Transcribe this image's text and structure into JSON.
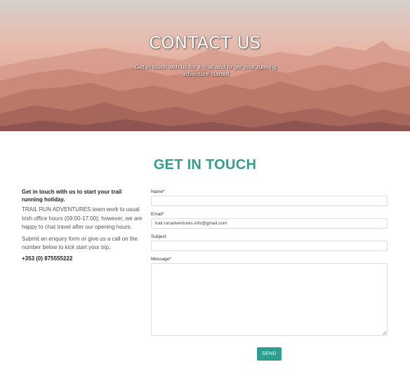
{
  "hero": {
    "title": "CONTACT US",
    "subtitle": "Get in touch with us for a chat and to get your running adventure started"
  },
  "section": {
    "title": "GET IN TOUCH"
  },
  "info": {
    "lead": "Get in touch with us to start your trail running holiday.",
    "para1": "TRAIL RUN ADVENTURES team work to usual Irish office hours (09:00-17:00); however, we are happy to chat travel after our opening hours.",
    "para2": "Submit an enquiry form or give us a call on the number below to kick start your trip.",
    "phone": "+353 (0) 875555222"
  },
  "form": {
    "name_label": "Name*",
    "name_value": "",
    "email_label": "Email*",
    "email_value": "trail.runadventures.info@gmail.com",
    "subject_label": "Subject",
    "subject_value": "",
    "message_label": "Message*",
    "message_value": "",
    "send_label": "SEND"
  },
  "colors": {
    "accent": "#2f9d8f",
    "heading": "#3a9a8c"
  }
}
